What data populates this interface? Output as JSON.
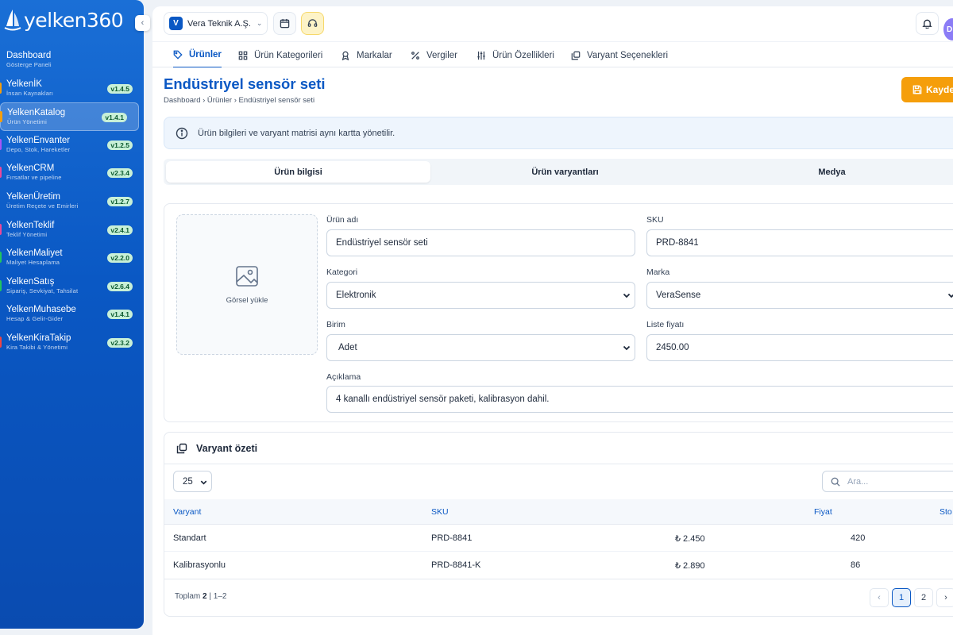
{
  "sidebar": {
    "logo_text": "yelken360",
    "items": [
      {
        "title": "Dashboard",
        "sub": "Gösterge Paneli",
        "badge": "",
        "dot": ""
      },
      {
        "title": "YelkenİK",
        "sub": "İnsan Kaynakları",
        "badge": "v1.4.5",
        "dot": "#f59e0b"
      },
      {
        "title": "YelkenKatalog",
        "sub": "Ürün Yönetimi",
        "badge": "v1.4.1",
        "dot": "#f59e0b"
      },
      {
        "title": "YelkenEnvanter",
        "sub": "Depo, Stok, Hareketler",
        "badge": "v1.2.5",
        "dot": "#a855f7"
      },
      {
        "title": "YelkenCRM",
        "sub": "Fırsatlar ve pipeline",
        "badge": "v2.3.4",
        "dot": "#ec4899"
      },
      {
        "title": "YelkenÜretim",
        "sub": "Üretim Reçete ve Emirleri",
        "badge": "v1.2.7",
        "dot": ""
      },
      {
        "title": "YelkenTeklif",
        "sub": "Teklif Yönetimi",
        "badge": "v2.4.1",
        "dot": "#ec4899"
      },
      {
        "title": "YelkenMaliyet",
        "sub": "Maliyet Hesaplama",
        "badge": "v2.2.0",
        "dot": "#22c55e"
      },
      {
        "title": "YelkenSatış",
        "sub": "Sipariş, Sevkiyat, Tahsilat",
        "badge": "v2.6.4",
        "dot": "#22c55e"
      },
      {
        "title": "YelkenMuhasebe",
        "sub": "Hesap & Gelir-Gider",
        "badge": "v1.4.1",
        "dot": ""
      },
      {
        "title": "YelkenKiraTakip",
        "sub": "Kira Takibi & Yönetimi",
        "badge": "v2.3.2",
        "dot": "#ef4444"
      }
    ]
  },
  "topbar": {
    "company_initial": "V",
    "company_name": "Vera Teknik A.Ş.",
    "avatar_initial": "D"
  },
  "tabs": [
    "Ürünler",
    "Ürün Kategorileri",
    "Markalar",
    "Vergiler",
    "Ürün Özellikleri",
    "Varyant Seçenekleri"
  ],
  "page": {
    "title": "Endüstriyel sensör seti",
    "breadcrumb": "Dashboard › Ürünler › Endüstriyel sensör seti",
    "save_label": "Kayde",
    "info": "Ürün bilgileri ve varyant matrisi aynı kartta yönetilir."
  },
  "segments": [
    "Ürün bilgisi",
    "Ürün varyantları",
    "Medya"
  ],
  "form": {
    "upload_label": "Görsel yükle",
    "name_label": "Ürün adı",
    "name_value": "Endüstriyel sensör seti",
    "sku_label": "SKU",
    "sku_value": "PRD-8841",
    "category_label": "Kategori",
    "category_value": "Elektronik",
    "brand_label": "Marka",
    "brand_value": "VeraSense",
    "unit_label": "Birim",
    "unit_value": "Adet",
    "price_label": "Liste fiyatı",
    "price_value": "2450.00",
    "desc_label": "Açıklama",
    "desc_value": "4 kanallı endüstriyel sensör paketi, kalibrasyon dahil."
  },
  "variants": {
    "title": "Varyant özeti",
    "page_size": "25",
    "search_placeholder": "Ara...",
    "columns": [
      "Varyant",
      "SKU",
      "Fiyat",
      "Sto"
    ],
    "rows": [
      {
        "name": "Standart",
        "sku": "PRD-8841",
        "price": "₺ 2.450",
        "stock": "420"
      },
      {
        "name": "Kalibrasyonlu",
        "sku": "PRD-8841-K",
        "price": "₺ 2.890",
        "stock": "86"
      }
    ],
    "total_label": "Toplam",
    "total_count": "2",
    "total_range": "| 1–2",
    "pages": [
      "1",
      "2"
    ]
  }
}
